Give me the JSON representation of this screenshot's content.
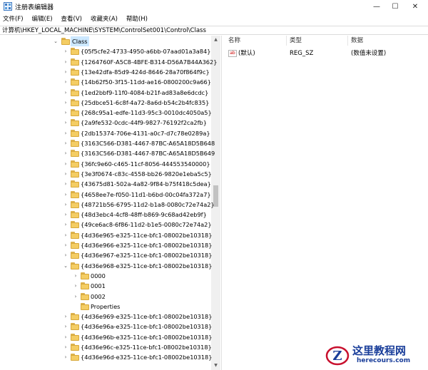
{
  "window": {
    "title": "注册表编辑器",
    "minimize": "—",
    "maximize": "☐",
    "close": "✕"
  },
  "menu": [
    "文件(F)",
    "编辑(E)",
    "查看(V)",
    "收藏夹(A)",
    "帮助(H)"
  ],
  "address": "计算机\\HKEY_LOCAL_MACHINE\\SYSTEM\\ControlSet001\\Control\\Class",
  "tree": {
    "root": "Class",
    "keys_top": [
      "{05f5cfe2-4733-4950-a6bb-07aad01a3a84}",
      "{1264760F-A5C8-4BFE-B314-D56A7B44A362}",
      "{13e42dfa-85d9-424d-8646-28a70f864f9c}",
      "{14b62f50-3f15-11dd-ae16-0800200c9a66}",
      "{1ed2bbf9-11f0-4084-b21f-ad83a8e6dcdc}",
      "{25dbce51-6c8f-4a72-8a6d-b54c2b4fc835}",
      "{268c95a1-edfe-11d3-95c3-0010dc4050a5}",
      "{2a9fe532-0cdc-44f9-9827-76192f2ca2fb}",
      "{2db15374-706e-4131-a0c7-d7c78e0289a}",
      "{3163C566-D381-4467-87BC-A65A18D5B648",
      "{3163C566-D381-4467-87BC-A65A18D5B649",
      "{36fc9e60-c465-11cf-8056-444553540000}",
      "{3e3f0674-c83c-4558-bb26-9820e1eba5c5}",
      "{43675d81-502a-4a82-9f84-b75f418c5dea}",
      "{4658ee7e-f050-11d1-b6bd-00c04fa372a7}",
      "{48721b56-6795-11d2-b1a8-0080c72e74a2}",
      "{48d3ebc4-4cf8-48ff-b869-9c68ad42eb9f}",
      "{49ce6ac8-6f86-11d2-b1e5-0080c72e74a2}",
      "{4d36e965-e325-11ce-bfc1-08002be10318}",
      "{4d36e966-e325-11ce-bfc1-08002be10318}",
      "{4d36e967-e325-11ce-bfc1-08002be10318}"
    ],
    "expanded_key": "{4d36e968-e325-11ce-bfc1-08002be10318}",
    "children": [
      "0000",
      "0001",
      "0002",
      "Properties"
    ],
    "keys_bottom": [
      "{4d36e969-e325-11ce-bfc1-08002be10318}",
      "{4d36e96a-e325-11ce-bfc1-08002be10318}",
      "{4d36e96b-e325-11ce-bfc1-08002be10318}",
      "{4d36e96c-e325-11ce-bfc1-08002be10318}",
      "{4d36e96d-e325-11ce-bfc1-08002be10318}"
    ]
  },
  "values": {
    "headers": {
      "name": "名称",
      "type": "类型",
      "data": "数据"
    },
    "rows": [
      {
        "name": "(默认)",
        "type": "REG_SZ",
        "data": "(数值未设置)",
        "icon": "ab"
      }
    ]
  },
  "watermark": {
    "title": "这里教程网",
    "url": "herecours.com"
  }
}
